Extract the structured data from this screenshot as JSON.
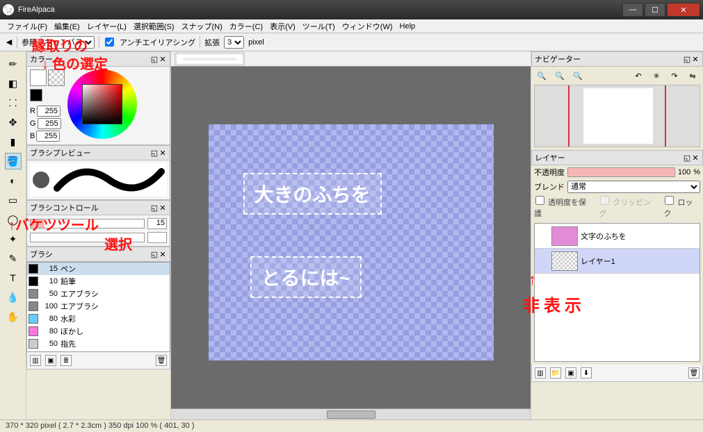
{
  "window": {
    "title": "FireAlpaca"
  },
  "menu": {
    "file": "ファイル(F)",
    "edit": "編集(E)",
    "layer": "レイヤー(L)",
    "select": "選択範囲(S)",
    "snap": "スナップ(N)",
    "color": "カラー(C)",
    "view": "表示(V)",
    "tool": "ツール(T)",
    "window": "ウィンドウ(W)",
    "help": "Help"
  },
  "toolbar": {
    "ref_label": "参照",
    "ref_value": "キャンバス",
    "aa_label": "アンチエイリアシング",
    "expand_label": "拡張",
    "expand_value": "3",
    "unit": "pixel"
  },
  "panels": {
    "color": "カラー",
    "brush_preview": "ブラシプレビュー",
    "brush_control": "ブラシコントロール",
    "brush": "ブラシ",
    "navigator": "ナビゲーター",
    "layer": "レイヤー"
  },
  "rgb": {
    "r_label": "R",
    "r": "255",
    "g_label": "G",
    "g": "255",
    "b_label": "B",
    "b": "255"
  },
  "brush_control": {
    "size_value": "15"
  },
  "brushes": [
    {
      "size": "15",
      "name": "ペン",
      "sel": true,
      "c": "#000"
    },
    {
      "size": "10",
      "name": "鉛筆",
      "c": "#000"
    },
    {
      "size": "50",
      "name": "エアブラシ",
      "c": "#888"
    },
    {
      "size": "100",
      "name": "エアブラシ",
      "c": "#888"
    },
    {
      "size": "80",
      "name": "水彩",
      "c": "#6cf"
    },
    {
      "size": "80",
      "name": "ぼかし",
      "c": "#f7d"
    },
    {
      "size": "50",
      "name": "指先",
      "c": "#ccc"
    }
  ],
  "layer_panel": {
    "opacity_label": "不透明度",
    "opacity_value": "100",
    "opacity_unit": "%",
    "blend_label": "ブレンド",
    "blend_value": "通常",
    "protect_alpha": "透明度を保護",
    "clipping": "クリッピング",
    "lock": "ロック"
  },
  "layers": [
    {
      "name": "文字のふちを",
      "sel": false,
      "eye": ""
    },
    {
      "name": "レイヤー1",
      "sel": true,
      "eye": ""
    }
  ],
  "canvas_text": {
    "line1": "大きのふちを",
    "line2": "とるには~"
  },
  "status": "370 * 320 pixel   ( 2.7 * 2.3cm )    350 dpi    100 %    ( 401, 30 )",
  "annotations": {
    "a1": "縁取りの",
    "a1b": "↓   色の選定",
    "a2": "↑バケツツール",
    "a2b": "選択",
    "a3": "↑",
    "a3b": "非表示"
  }
}
